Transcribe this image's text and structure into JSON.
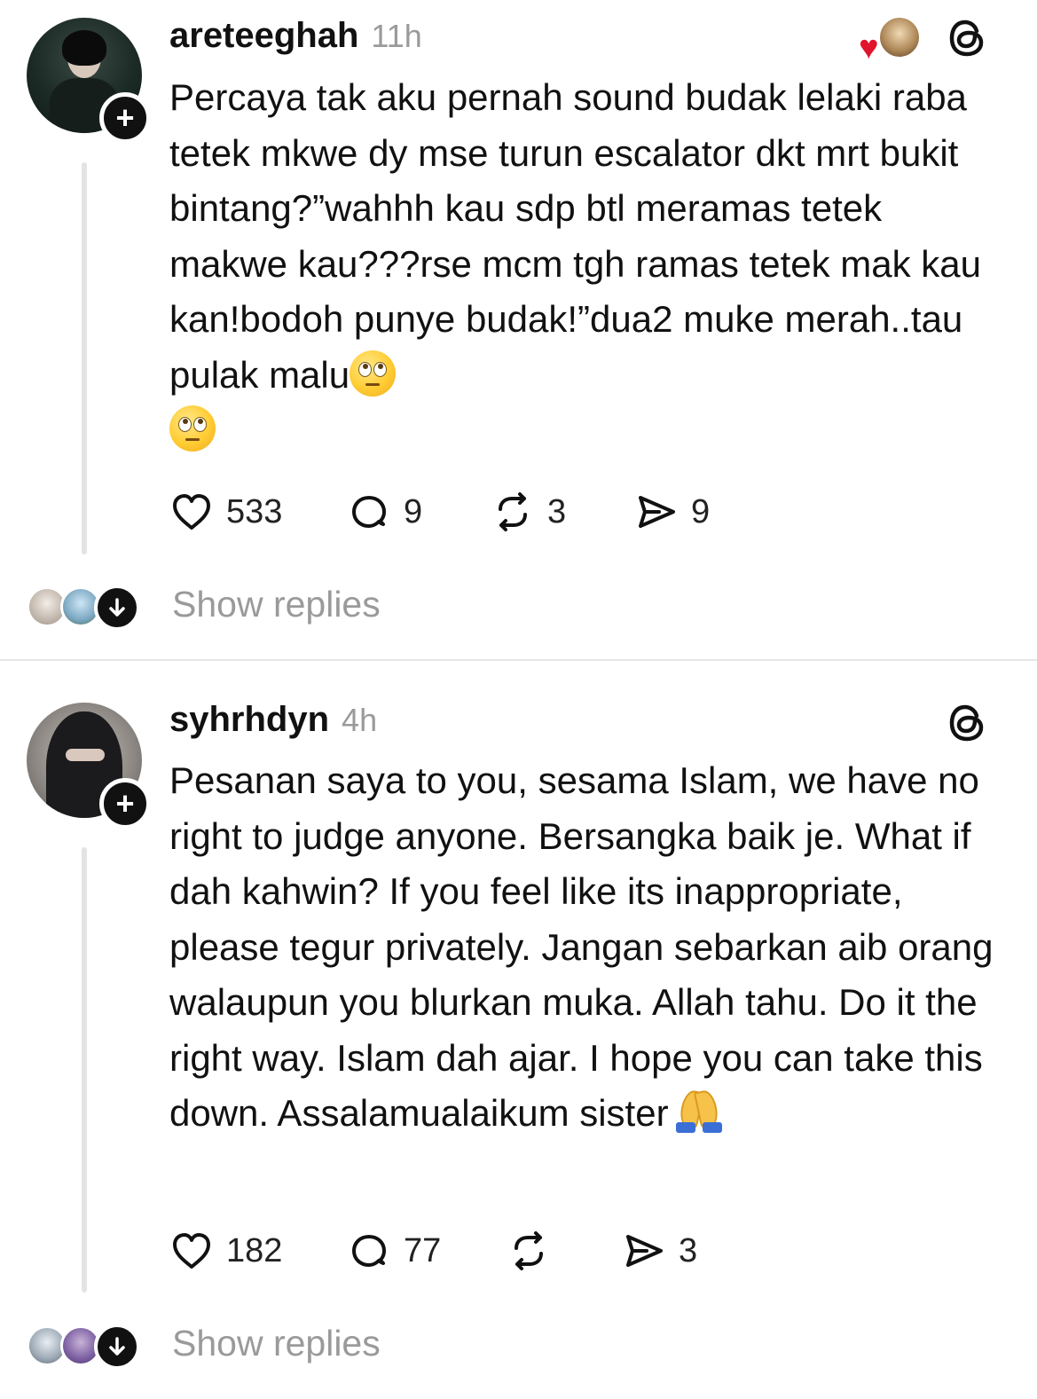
{
  "posts": [
    {
      "username": "areteeghah",
      "time": "11h",
      "text": "Percaya tak aku pernah sound budak lelaki raba tetek mkwe dy mse turun escalator dkt mrt bukit bintang?”wahhh kau sdp btl meramas tetek makwe kau???rse mcm tgh ramas tetek mak kau kan!bodoh punye budak!”dua2 muke merah..tau pulak malu",
      "trailing_emoji": [
        "face-with-rolling-eyes",
        "face-with-rolling-eyes"
      ],
      "likes": "533",
      "comments": "9",
      "reposts": "3",
      "shares": "9",
      "show_replies": "Show replies",
      "liked_by_icons": [
        "heart-icon",
        "liker-avatar"
      ]
    },
    {
      "username": "syhrhdyn",
      "time": "4h",
      "text": "Pesanan saya to you, sesama Islam, we have no right to judge anyone. Bersangka baik je. What if dah kahwin? If you feel like its inappropriate, please tegur privately. Jangan sebarkan aib orang walaupun you blurkan muka. Allah tahu. Do it the right way. Islam dah ajar. I hope you can take this down. Assalamualaikum sister",
      "trailing_emoji": [
        "folded-hands"
      ],
      "likes": "182",
      "comments": "77",
      "reposts": "",
      "shares": "3",
      "show_replies": "Show replies"
    }
  ],
  "icons": {
    "follow": "plus-icon",
    "like": "heart-outline-icon",
    "comment": "comment-bubble-icon",
    "repost": "repost-icon",
    "share": "send-icon",
    "platform": "threads-logo-icon",
    "expand_replies": "arrow-down-icon"
  },
  "colors": {
    "text": "#111111",
    "muted": "#9a9a9a",
    "thread_line": "#e3e3e3",
    "heart": "#e0142c"
  }
}
